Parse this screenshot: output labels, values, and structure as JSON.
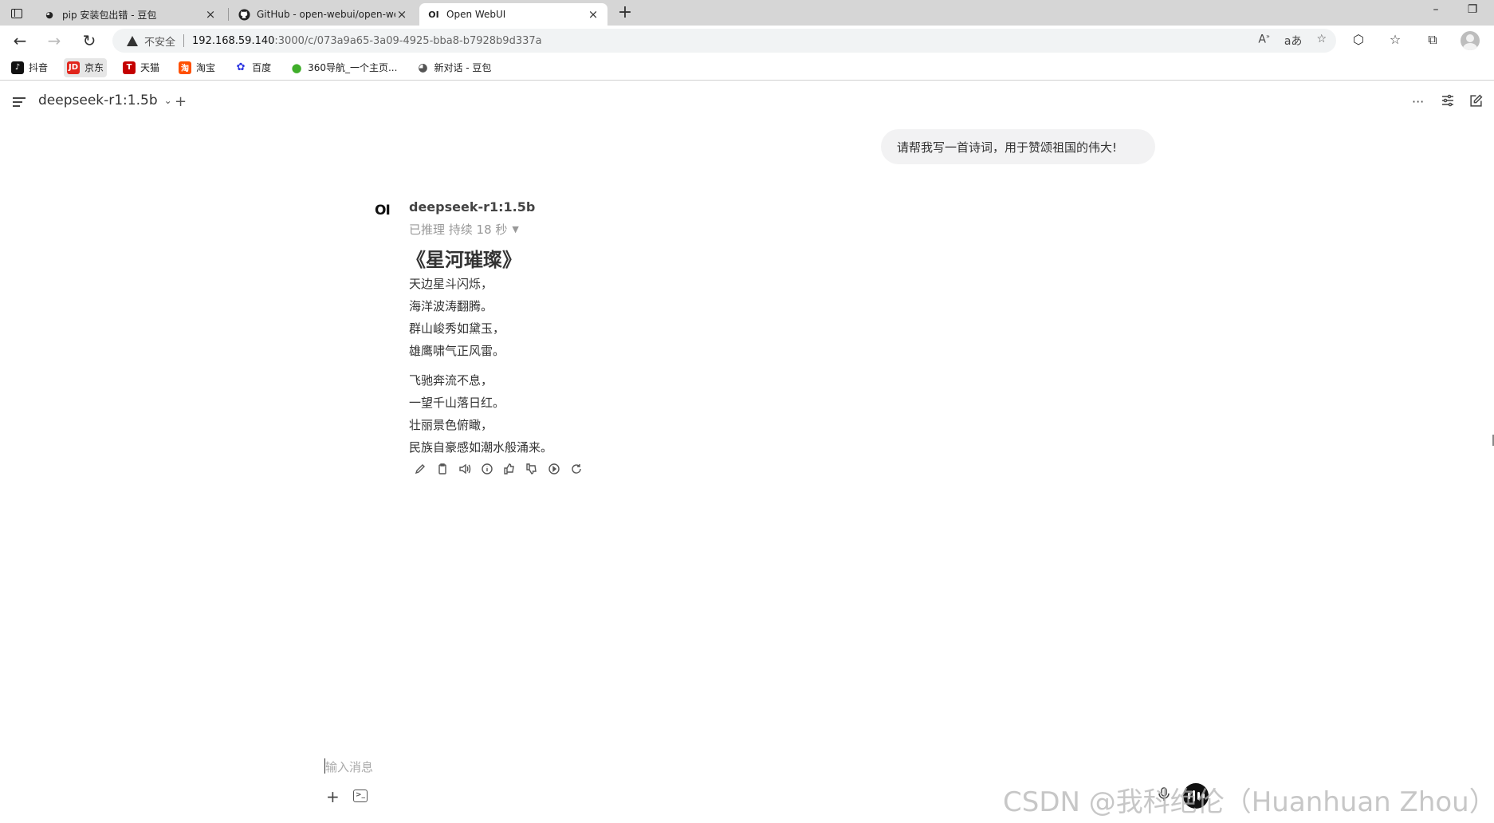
{
  "browser": {
    "tabs": [
      {
        "title": "pip 安装包出错 - 豆包",
        "favicon": "doubao-icon"
      },
      {
        "title": "GitHub - open-webui/open-webui",
        "favicon": "github-icon"
      },
      {
        "title": "Open WebUI",
        "favicon": "openwebui-icon",
        "favicon_text": "OI"
      }
    ],
    "tab_close": "×",
    "new_tab": "+",
    "window_controls": {
      "minimize": "–",
      "restore": "❐"
    },
    "security_label": "不安全",
    "url_host": "192.168.59.140",
    "url_rest": ":3000/c/073a9a65-3a09-4925-bba8-b7928b9d337a",
    "bookmarks": [
      {
        "label": "抖音",
        "color": "#111111",
        "glyph": "♪"
      },
      {
        "label": "京东",
        "color": "#e1251b",
        "glyph": "JD"
      },
      {
        "label": "天猫",
        "color": "#c40000",
        "glyph": "T"
      },
      {
        "label": "淘宝",
        "color": "#ff5000",
        "glyph": "淘"
      },
      {
        "label": "百度",
        "color": "#2932e1",
        "glyph": "✿"
      },
      {
        "label": "360导航_一个主页...",
        "color": "#3fae2a",
        "glyph": "●"
      },
      {
        "label": "新对话 - 豆包",
        "color": "#555555",
        "glyph": "◕"
      }
    ]
  },
  "app": {
    "model_name": "deepseek-r1:1.5b",
    "user_message": "请帮我写一首诗词，用于赞颂祖国的伟大!",
    "assistant": {
      "logo": "OI",
      "name": "deepseek-r1:1.5b",
      "reasoning": "已推理 持续 18 秒",
      "poem_title": "《星河璀璨》",
      "stanza1": [
        "天边星斗闪烁，",
        "海洋波涛翻腾。",
        "群山峻秀如黛玉，",
        "雄鹰啸气正风雷。"
      ],
      "stanza2": [
        "飞驰奔流不息，",
        "一望千山落日红。",
        "壮丽景色俯瞰，",
        "民族自豪感如潮水般涌来。"
      ]
    },
    "composer_placeholder": "输入消息"
  },
  "watermark": "CSDN @我科绝伦（Huanhuan Zhou）"
}
